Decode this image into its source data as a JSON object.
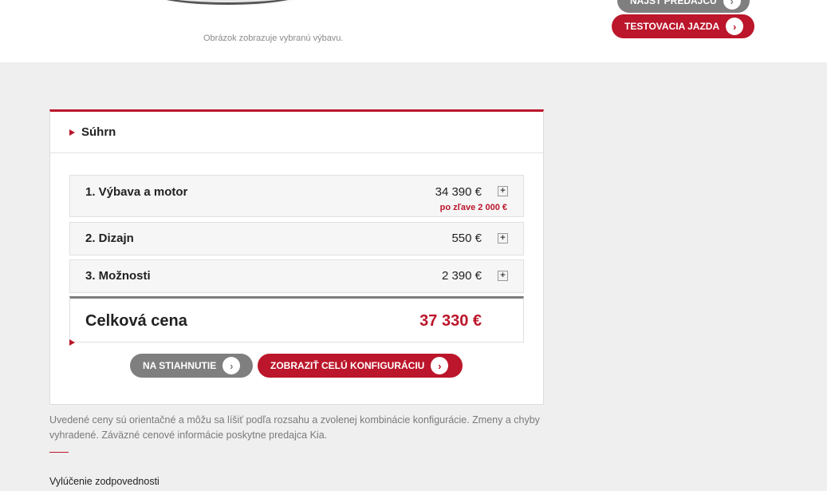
{
  "hero": {
    "caption": "Obrázok zobrazuje vybranú výbavu."
  },
  "actions": {
    "find_dealer": "NÁJSŤ PREDAJCU",
    "test_drive": "TESTOVACIA JAZDA"
  },
  "summary": {
    "title": "Súhrn",
    "rows": [
      {
        "label": "1. Výbava a motor",
        "price": "34 390 €",
        "discount": "po zľave 2 000 €"
      },
      {
        "label": "2. Dizajn",
        "price": "550 €"
      },
      {
        "label": "3. Možnosti",
        "price": "2 390 €"
      }
    ],
    "total_label": "Celková cena",
    "total_price": "37 330 €",
    "download_label": "NA STIAHNUTIE",
    "full_config_label": "ZOBRAZIŤ CELÚ KONFIGURÁCIU"
  },
  "note": "Uvedené ceny sú orientačné a môžu sa líšiť podľa rozsahu a zvolenej kombinácie konfigurácie. Zmeny a chyby vyhradené. Záväzné cenové informácie poskytne predajca Kia.",
  "disclaimer_link": "Vylúčenie zodpovednosti",
  "colors": {
    "brand_red": "#bb162b",
    "button_grey": "#7f7f7f"
  },
  "icons": {
    "pill_arrow": "chevron-right-icon",
    "expand": "plus-icon",
    "section_marker": "triangle-right-icon"
  }
}
